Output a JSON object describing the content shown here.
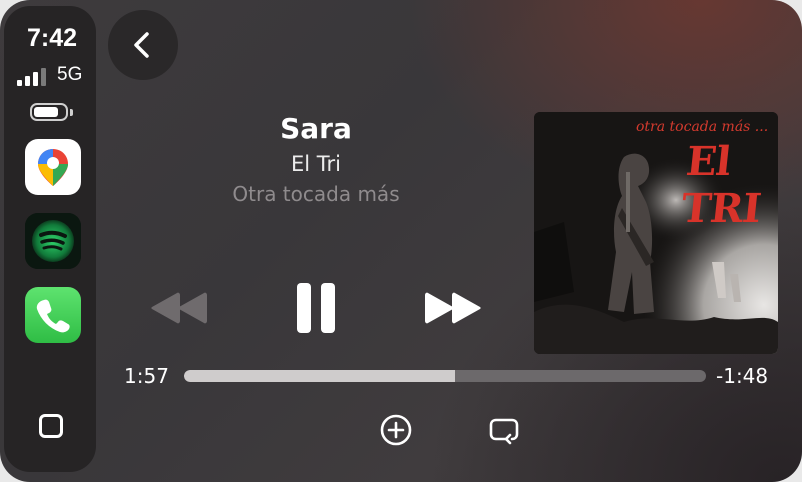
{
  "status": {
    "time": "7:42",
    "network": "5G"
  },
  "sidebar": {
    "apps": [
      {
        "name": "Google Maps",
        "icon": "maps-pin-icon"
      },
      {
        "name": "Spotify",
        "icon": "spotify-icon"
      },
      {
        "name": "Phone",
        "icon": "phone-icon"
      }
    ]
  },
  "track": {
    "title": "Sara",
    "artist": "El Tri",
    "album": "Otra tocada más"
  },
  "artwork": {
    "title_text": "otra tocada más ...",
    "band_text": "El TRI"
  },
  "playback": {
    "elapsed": "1:57",
    "remaining": "-1:48",
    "progress": 0.52,
    "state": "playing"
  },
  "colors": {
    "accent_red": "#d8332a",
    "spotify_green": "#1db954",
    "phone_green": "#35c759"
  }
}
